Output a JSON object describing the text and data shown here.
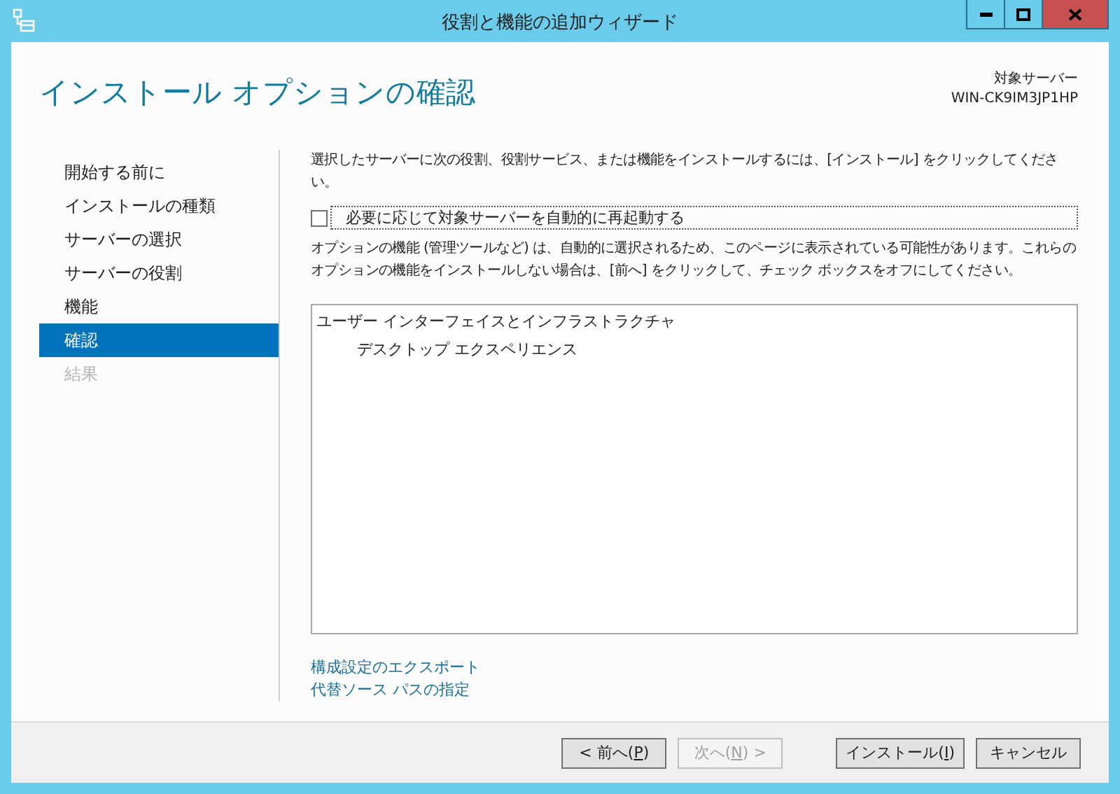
{
  "window": {
    "title": "役割と機能の追加ウィザード"
  },
  "header": {
    "title": "インストール オプションの確認",
    "target_label": "対象サーバー",
    "target_name": "WIN-CK9IM3JP1HP"
  },
  "steps": [
    {
      "label": "開始する前に",
      "selected": false,
      "disabled": false
    },
    {
      "label": "インストールの種類",
      "selected": false,
      "disabled": false
    },
    {
      "label": "サーバーの選択",
      "selected": false,
      "disabled": false
    },
    {
      "label": "サーバーの役割",
      "selected": false,
      "disabled": false
    },
    {
      "label": "機能",
      "selected": false,
      "disabled": false
    },
    {
      "label": "確認",
      "selected": true,
      "disabled": false
    },
    {
      "label": "結果",
      "selected": false,
      "disabled": true
    }
  ],
  "instruction": "選択したサーバーに次の役割、役割サービス、または機能をインストールするには、[インストール] をクリックしてください。",
  "restart_checkbox": {
    "label": "必要に応じて対象サーバーを自動的に再起動する",
    "checked": false,
    "focused": true
  },
  "note": "オプションの機能 (管理ツールなど) は、自動的に選択されるため、このページに表示されている可能性があります。これらのオプションの機能をインストールしない場合は、[前へ] をクリックして、チェック ボックスをオフにしてください。",
  "features": [
    {
      "label": "ユーザー インターフェイスとインフラストラクチャ",
      "children": [
        {
          "label": "デスクトップ エクスペリエンス"
        }
      ]
    }
  ],
  "links": [
    "構成設定のエクスポート",
    "代替ソース パスの指定"
  ],
  "buttons": [
    {
      "before": "< 前へ(",
      "access_key": "P",
      "after": ")",
      "disabled": false,
      "kind": "back"
    },
    {
      "before": "次へ(",
      "access_key": "N",
      "after": ") >",
      "disabled": true,
      "kind": "next"
    },
    {
      "before": "インストール(",
      "access_key": "I",
      "after": ")",
      "disabled": false,
      "kind": "install"
    },
    {
      "after": "キャンセル",
      "disabled": false,
      "kind": "cancel"
    }
  ]
}
